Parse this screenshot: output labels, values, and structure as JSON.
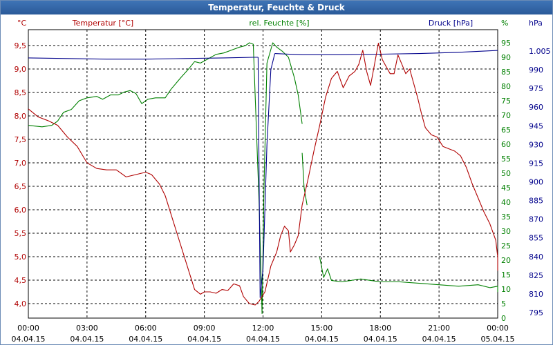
{
  "window": {
    "title": "Temperatur, Feuchte & Druck"
  },
  "colors": {
    "temperature": "#b00000",
    "humidity": "#008000",
    "pressure": "#00008b",
    "titlebar": "#2f62a6",
    "grid": "#000000"
  },
  "chart_data": {
    "type": "line",
    "title": "Temperatur, Feuchte & Druck",
    "grid": true,
    "x_range": [
      "00:00 04.04.15",
      "00:00 05.04.15"
    ],
    "x_ticks": [
      {
        "time": "00:00",
        "date": "04.04.15"
      },
      {
        "time": "03:00",
        "date": "04.04.15"
      },
      {
        "time": "06:00",
        "date": "04.04.15"
      },
      {
        "time": "09:00",
        "date": "04.04.15"
      },
      {
        "time": "12:00",
        "date": "04.04.15"
      },
      {
        "time": "15:00",
        "date": "04.04.15"
      },
      {
        "time": "18:00",
        "date": "04.04.15"
      },
      {
        "time": "21:00",
        "date": "04.04.15"
      },
      {
        "time": "00:00",
        "date": "05.04.15"
      }
    ],
    "axes": {
      "temperature": {
        "unit": "°C",
        "label": "Temperatur [°C]",
        "ylim": [
          3.9,
          9.6
        ],
        "ticks": [
          "4,0",
          "4,5",
          "5,0",
          "5,5",
          "6,0",
          "6,5",
          "7,0",
          "7,5",
          "8,0",
          "8,5",
          "9,0",
          "9,5"
        ]
      },
      "humidity": {
        "unit": "%",
        "label": "rel. Feuchte [%]",
        "ylim": [
          0,
          95
        ],
        "ticks": [
          "0",
          "5",
          "10",
          "15",
          "20",
          "25",
          "30",
          "35",
          "40",
          "45",
          "50",
          "55",
          "60",
          "65",
          "70",
          "75",
          "80",
          "85",
          "90",
          "95"
        ]
      },
      "pressure": {
        "unit": "hPa",
        "label": "Druck [hPa]",
        "ylim": [
          795,
          1005
        ],
        "ticks": [
          "795",
          "810",
          "825",
          "840",
          "855",
          "870",
          "885",
          "900",
          "915",
          "930",
          "945",
          "960",
          "975",
          "990",
          "1.005"
        ]
      }
    },
    "series": [
      {
        "name": "Temperatur [°C]",
        "axis": "temperature",
        "segments": [
          [
            [
              0.0,
              8.15
            ],
            [
              0.5,
              7.98
            ],
            [
              1.0,
              7.9
            ],
            [
              1.5,
              7.8
            ],
            [
              2.0,
              7.55
            ],
            [
              2.5,
              7.35
            ],
            [
              3.0,
              7.0
            ],
            [
              3.5,
              6.88
            ],
            [
              4.0,
              6.85
            ],
            [
              4.5,
              6.85
            ],
            [
              5.0,
              6.7
            ],
            [
              5.5,
              6.75
            ],
            [
              6.0,
              6.8
            ],
            [
              6.3,
              6.75
            ],
            [
              6.7,
              6.55
            ],
            [
              7.0,
              6.3
            ],
            [
              7.3,
              5.9
            ],
            [
              7.6,
              5.5
            ],
            [
              7.9,
              5.1
            ],
            [
              8.2,
              4.7
            ],
            [
              8.5,
              4.3
            ],
            [
              8.8,
              4.2
            ],
            [
              9.0,
              4.25
            ],
            [
              9.3,
              4.25
            ],
            [
              9.6,
              4.22
            ],
            [
              9.9,
              4.3
            ],
            [
              10.2,
              4.28
            ],
            [
              10.5,
              4.42
            ],
            [
              10.8,
              4.38
            ],
            [
              11.0,
              4.15
            ],
            [
              11.3,
              4.0
            ],
            [
              11.6,
              3.97
            ],
            [
              11.8,
              4.05
            ],
            [
              12.1,
              4.25
            ],
            [
              12.4,
              4.8
            ],
            [
              12.7,
              5.1
            ],
            [
              12.9,
              5.45
            ],
            [
              13.1,
              5.65
            ],
            [
              13.3,
              5.55
            ],
            [
              13.4,
              5.1
            ],
            [
              13.6,
              5.25
            ],
            [
              13.8,
              5.45
            ],
            [
              14.0,
              6.1
            ],
            [
              14.3,
              6.65
            ],
            [
              14.6,
              7.25
            ],
            [
              14.9,
              7.8
            ],
            [
              15.2,
              8.4
            ],
            [
              15.5,
              8.8
            ],
            [
              15.8,
              8.95
            ],
            [
              16.1,
              8.6
            ],
            [
              16.4,
              8.85
            ],
            [
              16.7,
              8.95
            ],
            [
              16.9,
              9.1
            ],
            [
              17.1,
              9.4
            ],
            [
              17.3,
              8.95
            ],
            [
              17.5,
              8.65
            ],
            [
              17.7,
              9.1
            ],
            [
              17.9,
              9.55
            ],
            [
              18.1,
              9.2
            ],
            [
              18.3,
              9.05
            ],
            [
              18.5,
              8.9
            ],
            [
              18.7,
              8.9
            ],
            [
              18.9,
              9.3
            ],
            [
              19.1,
              9.1
            ],
            [
              19.3,
              8.9
            ],
            [
              19.5,
              9.0
            ],
            [
              19.7,
              8.7
            ],
            [
              19.9,
              8.4
            ],
            [
              20.1,
              8.05
            ],
            [
              20.3,
              7.75
            ],
            [
              20.6,
              7.6
            ],
            [
              20.9,
              7.55
            ],
            [
              21.2,
              7.35
            ],
            [
              21.5,
              7.3
            ],
            [
              21.8,
              7.25
            ],
            [
              22.1,
              7.15
            ],
            [
              22.4,
              6.9
            ],
            [
              22.7,
              6.55
            ],
            [
              23.0,
              6.25
            ],
            [
              23.3,
              5.95
            ],
            [
              23.6,
              5.7
            ],
            [
              23.9,
              5.35
            ],
            [
              24.2,
              5.0
            ],
            [
              24.4,
              4.85
            ],
            [
              24.6,
              4.7
            ]
          ]
        ]
      },
      {
        "name": "rel. Feuchte [%]",
        "axis": "humidity",
        "segments": [
          [
            [
              0.0,
              66.5
            ],
            [
              0.7,
              66
            ],
            [
              1.2,
              66.5
            ],
            [
              1.5,
              68
            ],
            [
              1.8,
              71
            ],
            [
              2.2,
              72
            ],
            [
              2.6,
              75
            ],
            [
              3.0,
              76
            ],
            [
              3.5,
              76.5
            ],
            [
              3.8,
              75.5
            ],
            [
              4.2,
              77
            ],
            [
              4.6,
              77
            ],
            [
              4.9,
              78
            ],
            [
              5.2,
              78.5
            ],
            [
              5.5,
              77.5
            ],
            [
              5.8,
              74
            ],
            [
              6.1,
              75.5
            ],
            [
              6.5,
              76
            ],
            [
              7.0,
              76
            ],
            [
              7.3,
              79
            ],
            [
              7.8,
              83
            ],
            [
              8.2,
              86
            ],
            [
              8.5,
              88.5
            ],
            [
              8.8,
              88
            ],
            [
              9.2,
              89.5
            ],
            [
              9.6,
              91
            ],
            [
              10.0,
              91.5
            ],
            [
              10.4,
              92.5
            ],
            [
              10.8,
              93.5
            ],
            [
              11.1,
              94
            ],
            [
              11.3,
              95
            ],
            [
              11.5,
              94.5
            ],
            [
              11.8,
              40
            ],
            [
              11.95,
              1.5
            ]
          ],
          [
            [
              11.95,
              1.5
            ],
            [
              12.05,
              45
            ],
            [
              12.2,
              88
            ],
            [
              12.5,
              95
            ],
            [
              12.7,
              93.5
            ],
            [
              13.0,
              92
            ],
            [
              13.3,
              90
            ],
            [
              13.6,
              83
            ],
            [
              13.8,
              77
            ],
            [
              14.0,
              67
            ]
          ],
          [
            [
              14.0,
              57
            ],
            [
              14.1,
              45
            ],
            [
              14.25,
              39
            ]
          ],
          [
            [
              14.9,
              21
            ],
            [
              15.1,
              14
            ],
            [
              15.3,
              17
            ],
            [
              15.5,
              13
            ],
            [
              16.0,
              12.5
            ],
            [
              16.5,
              13
            ],
            [
              17.0,
              13.5
            ],
            [
              17.5,
              13
            ],
            [
              18.0,
              12.5
            ],
            [
              19.0,
              12.5
            ],
            [
              20.0,
              12
            ],
            [
              21.0,
              11.5
            ],
            [
              22.0,
              11
            ],
            [
              23.0,
              11.5
            ],
            [
              23.6,
              10.5
            ],
            [
              24.0,
              11
            ],
            [
              24.4,
              9.5
            ],
            [
              24.6,
              9
            ]
          ]
        ]
      },
      {
        "name": "Druck [hPa]",
        "axis": "pressure",
        "segments": [
          [
            [
              0.0,
              999.5
            ],
            [
              2.0,
              999
            ],
            [
              4.0,
              998.5
            ],
            [
              6.0,
              998.5
            ],
            [
              8.0,
              999
            ],
            [
              10.0,
              999.5
            ],
            [
              11.5,
              1000
            ],
            [
              11.75,
              1000
            ]
          ],
          [
            [
              11.75,
              1000
            ],
            [
              11.85,
              807
            ],
            [
              12.0,
              830
            ],
            [
              12.2,
              930
            ],
            [
              12.4,
              990
            ],
            [
              12.6,
              1003
            ]
          ],
          [
            [
              12.6,
              1003
            ],
            [
              14.0,
              1002
            ],
            [
              16.0,
              1002
            ],
            [
              18.0,
              1002.5
            ],
            [
              20.0,
              1003
            ],
            [
              22.0,
              1004
            ],
            [
              24.0,
              1005.5
            ],
            [
              24.6,
              1005.5
            ]
          ]
        ]
      }
    ]
  }
}
